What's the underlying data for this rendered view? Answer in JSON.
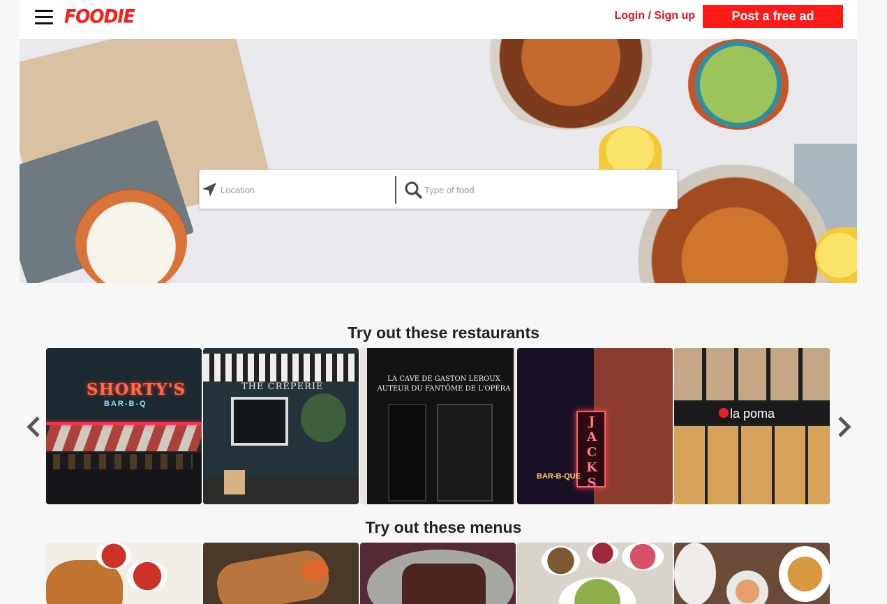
{
  "header": {
    "logo": "FOODIE",
    "login_label": "Login / Sign up",
    "post_ad_label": "Post a free ad"
  },
  "search": {
    "location_placeholder": "Location",
    "food_placeholder": "Type of food"
  },
  "restaurants": {
    "title": "Try out these restaurants",
    "cards": [
      {
        "sign": "SHORTY'S",
        "subsign": "BAR-B-Q"
      },
      {
        "sign": "THE CRÊPERIE"
      },
      {
        "sign": "LA CAVE DE GASTON LEROUX",
        "subsign": "AUTEUR DU FANTÔME DE L'OPÉRA"
      },
      {
        "sign": "JACKS",
        "subsign": "BAR-B-QUE"
      },
      {
        "sign": "la poma"
      }
    ]
  },
  "menus": {
    "title": "Try out these menus"
  },
  "colors": {
    "brand": "#ff1a1a",
    "login": "#e8121c"
  }
}
